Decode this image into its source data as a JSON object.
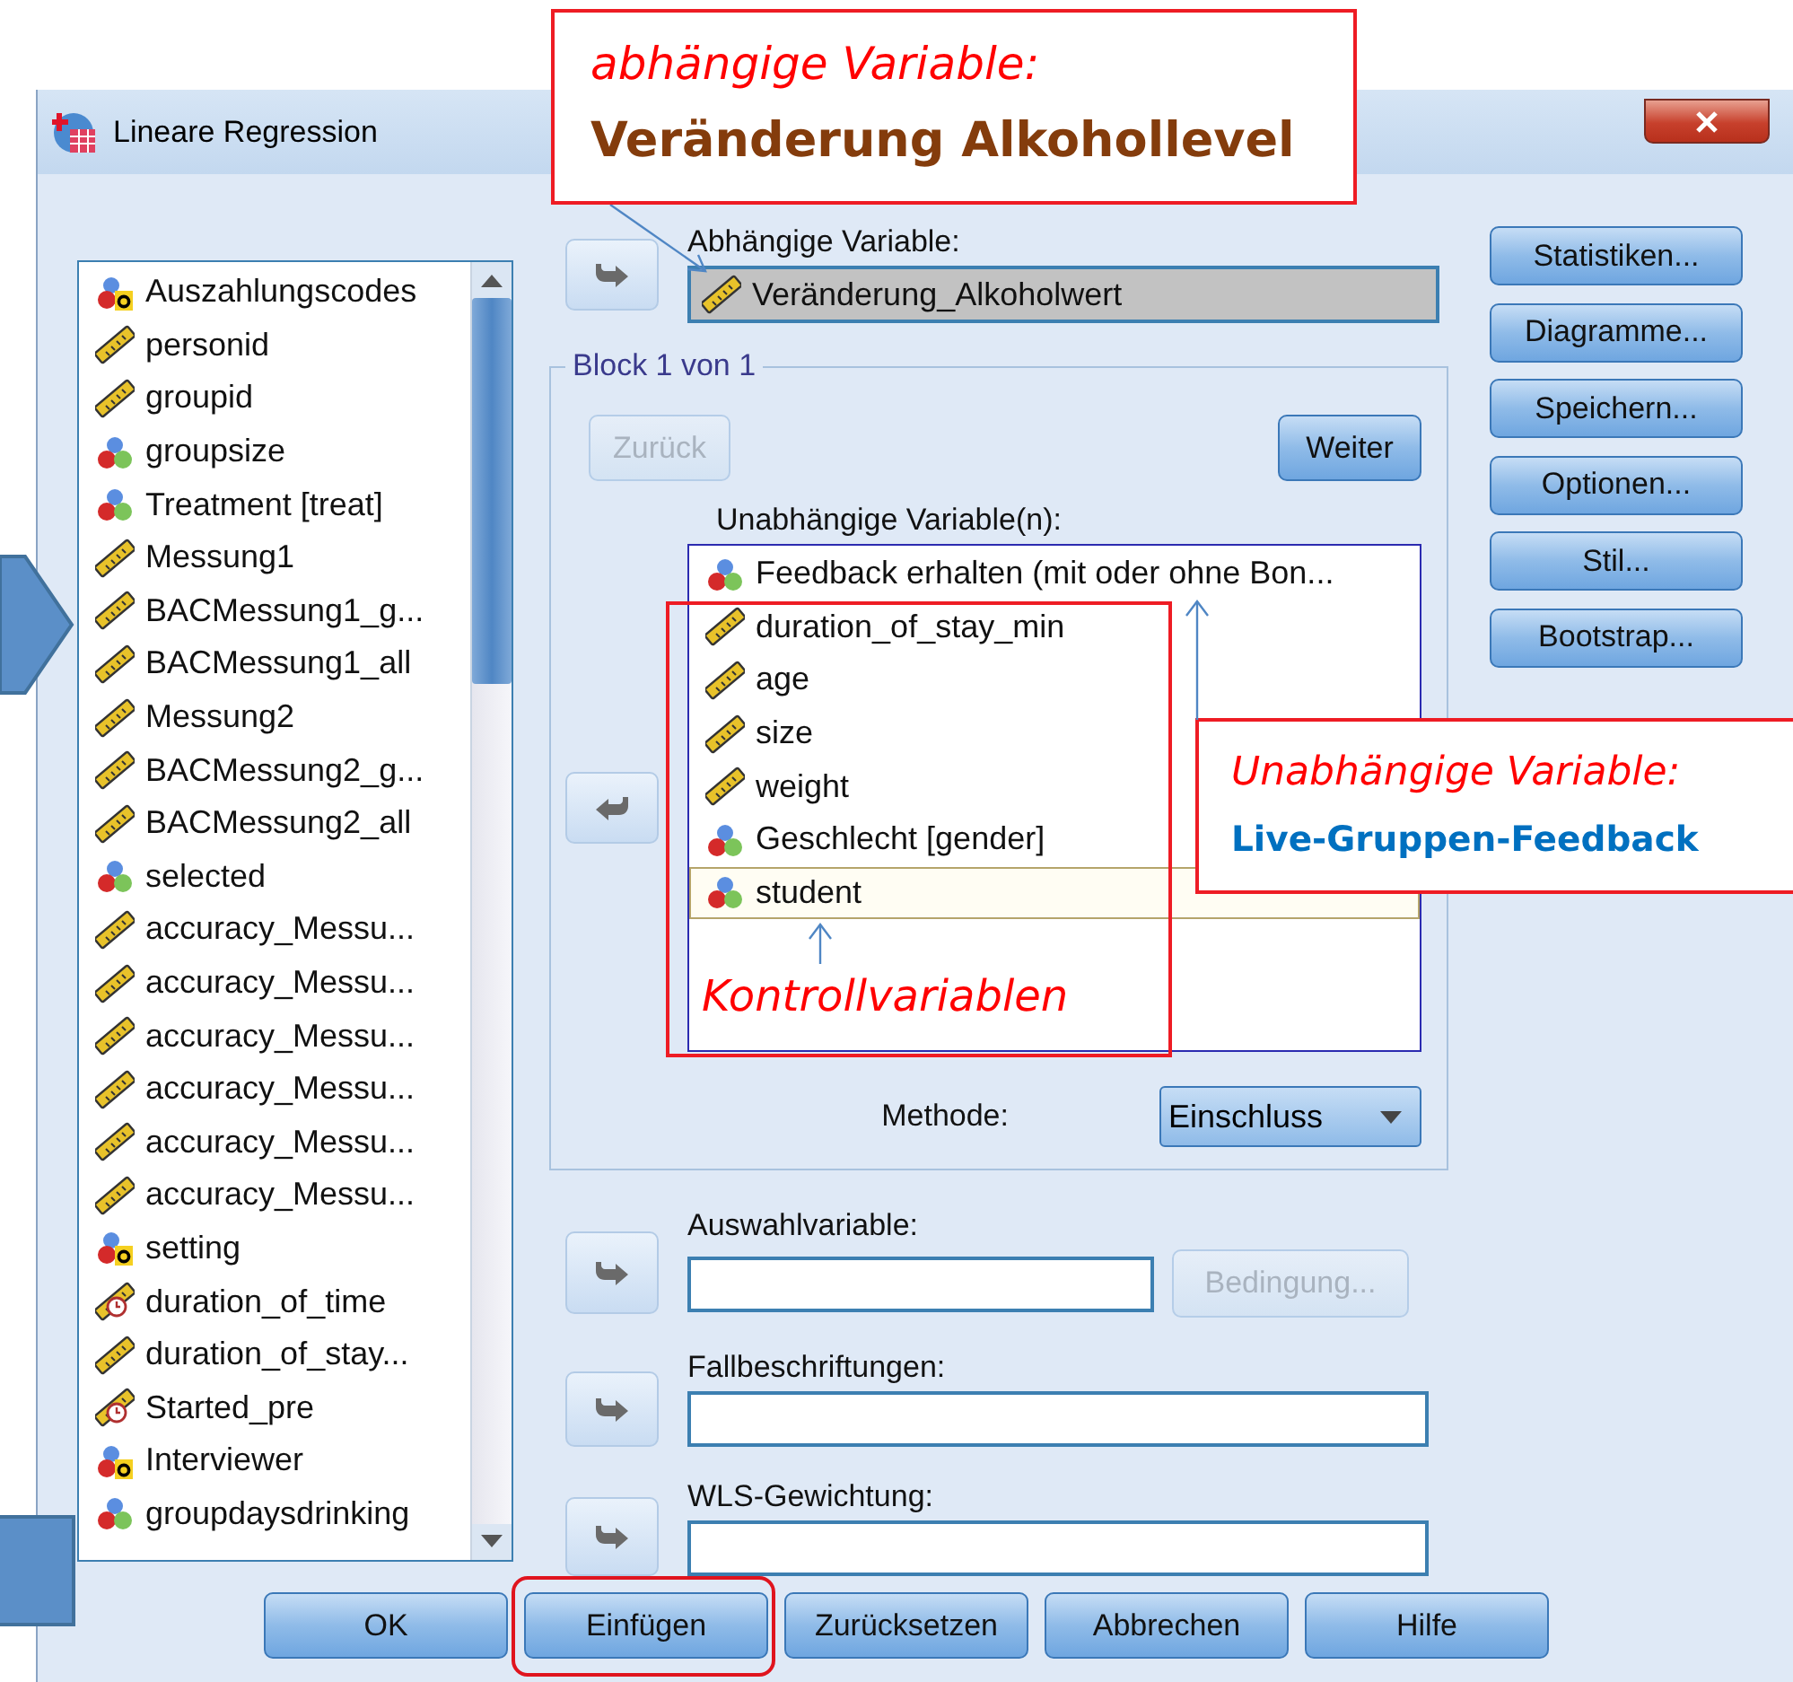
{
  "window": {
    "title": "Lineare Regression"
  },
  "source_variables": [
    {
      "name": "Auszahlungscodes",
      "kind": "string"
    },
    {
      "name": "personid",
      "kind": "scale"
    },
    {
      "name": "groupid",
      "kind": "scale"
    },
    {
      "name": "groupsize",
      "kind": "nominal"
    },
    {
      "name": "Treatment [treat]",
      "kind": "nominal"
    },
    {
      "name": "Messung1",
      "kind": "scale"
    },
    {
      "name": "BACMessung1_g...",
      "kind": "scale"
    },
    {
      "name": "BACMessung1_all",
      "kind": "scale"
    },
    {
      "name": "Messung2",
      "kind": "scale"
    },
    {
      "name": "BACMessung2_g...",
      "kind": "scale"
    },
    {
      "name": "BACMessung2_all",
      "kind": "scale"
    },
    {
      "name": "selected",
      "kind": "nominal"
    },
    {
      "name": "accuracy_Messu...",
      "kind": "scale"
    },
    {
      "name": "accuracy_Messu...",
      "kind": "scale"
    },
    {
      "name": "accuracy_Messu...",
      "kind": "scale"
    },
    {
      "name": "accuracy_Messu...",
      "kind": "scale"
    },
    {
      "name": "accuracy_Messu...",
      "kind": "scale"
    },
    {
      "name": "accuracy_Messu...",
      "kind": "scale"
    },
    {
      "name": "setting",
      "kind": "string"
    },
    {
      "name": "duration_of_time",
      "kind": "date"
    },
    {
      "name": "duration_of_stay...",
      "kind": "scale"
    },
    {
      "name": "Started_pre",
      "kind": "date"
    },
    {
      "name": "Interviewer",
      "kind": "string"
    },
    {
      "name": "groupdaysdrinking",
      "kind": "nominal"
    }
  ],
  "dependent": {
    "label": "Abhängige Variable:",
    "name": "Veränderung_Alkoholwert",
    "kind": "scale"
  },
  "block": {
    "title": "Block 1 von 1",
    "previous": {
      "label": "Zurück",
      "disabled": true
    },
    "next": {
      "label": "Weiter",
      "disabled": false
    },
    "independent_label": "Unabhängige Variable(n):",
    "independent": [
      {
        "name": "Feedback erhalten (mit oder ohne Bon...",
        "kind": "nominal",
        "selected": false
      },
      {
        "name": "duration_of_stay_min",
        "kind": "scale",
        "selected": false
      },
      {
        "name": "age",
        "kind": "scale",
        "selected": false
      },
      {
        "name": "size",
        "kind": "scale",
        "selected": false
      },
      {
        "name": "weight",
        "kind": "scale",
        "selected": false
      },
      {
        "name": "Geschlecht [gender]",
        "kind": "nominal",
        "selected": false
      },
      {
        "name": "student",
        "kind": "nominal",
        "selected": true
      }
    ],
    "method_label": "Methode:",
    "method": "Einschluss"
  },
  "selection_variable": {
    "label": "Auswahlvariable:",
    "condition": {
      "label": "Bedingung...",
      "disabled": true
    }
  },
  "case_labels": {
    "label": "Fallbeschriftungen:"
  },
  "wls_weight": {
    "label": "WLS-Gewichtung:"
  },
  "side_buttons": [
    "Statistiken...",
    "Diagramme...",
    "Speichern...",
    "Optionen...",
    "Stil...",
    "Bootstrap..."
  ],
  "buttons": [
    {
      "label": "OK",
      "circled": false
    },
    {
      "label": "Einfügen",
      "circled": true
    },
    {
      "label": "Zurücksetzen",
      "circled": false
    },
    {
      "label": "Abbrechen",
      "circled": false
    },
    {
      "label": "Hilfe",
      "circled": false
    }
  ],
  "annotations": [
    {
      "caption": "abhängige Variable:",
      "detail": "Veränderung Alkohollevel",
      "color": "#843c0c"
    },
    {
      "caption": "Unabhängige Variable:",
      "detail": "Live-Gruppen-Feedback",
      "color": "#0070c0"
    },
    {
      "caption": "Kontrollvariablen"
    }
  ]
}
